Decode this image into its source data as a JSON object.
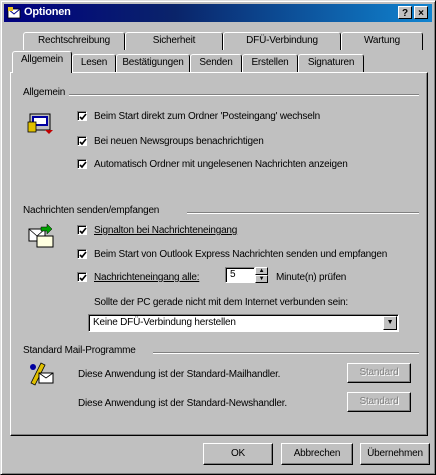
{
  "window": {
    "title": "Optionen"
  },
  "titlebar_buttons": {
    "help": "?",
    "close": "×"
  },
  "tabs_back": [
    "Rechtschreibung",
    "Sicherheit",
    "DFÜ-Verbindung",
    "Wartung"
  ],
  "tabs_front": [
    "Allgemein",
    "Lesen",
    "Bestätigungen",
    "Senden",
    "Erstellen",
    "Signaturen"
  ],
  "active_tab": "Allgemein",
  "groups": {
    "allgemein": {
      "title": "Allgemein",
      "options": [
        {
          "label": "Beim Start direkt zum Ordner 'Posteingang' wechseln",
          "checked": true
        },
        {
          "label": "Bei neuen Newsgroups benachrichtigen",
          "checked": true
        },
        {
          "label": "Automatisch Ordner mit ungelesenen Nachrichten anzeigen",
          "checked": true
        }
      ]
    },
    "senden": {
      "title": "Nachrichten senden/empfangen",
      "options": [
        {
          "label": "Signalton bei Nachrichteneingang",
          "checked": true
        },
        {
          "label": "Beim Start von Outlook Express Nachrichten senden und empfangen",
          "checked": true
        },
        {
          "label": "Nachrichteneingang alle:",
          "checked": true
        }
      ],
      "interval_value": "5",
      "interval_unit": "Minute(n) prüfen",
      "offline_prompt": "Sollte der PC gerade nicht mit dem Internet verbunden sein:",
      "offline_select": "Keine DFÜ-Verbindung herstellen"
    },
    "mail": {
      "title": "Standard Mail-Programme",
      "mail_text": "Diese Anwendung ist der Standard-Mailhandler.",
      "news_text": "Diese Anwendung ist der Standard-Newshandler.",
      "mail_button": "Standard",
      "news_button": "Standard"
    }
  },
  "footer": {
    "ok": "OK",
    "cancel": "Abbrechen",
    "apply": "Übernehmen"
  },
  "colors": {
    "title_start": "#000080",
    "title_end": "#1084d0",
    "face": "#c0c0c0"
  }
}
